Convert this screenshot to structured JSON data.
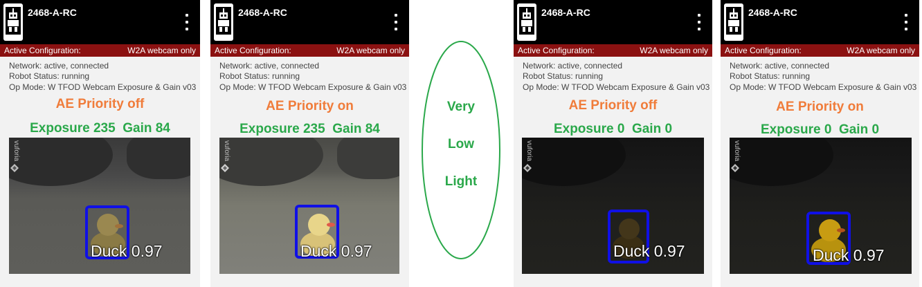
{
  "panels": [
    {
      "device": "2468-A-RC",
      "config_label": "Active Configuration:",
      "config_value": "W2A webcam only",
      "network": "Network: active, connected",
      "robot_status": "Robot Status: running",
      "op_mode": "Op Mode: W TFOD Webcam Exposure & Gain v03",
      "ae_priority": "AE Priority off",
      "exposure_gain": "Exposure 235  Gain 84",
      "vuforia": "vuforia",
      "detection": "Duck 0.97"
    },
    {
      "device": "2468-A-RC",
      "config_label": "Active Configuration:",
      "config_value": "W2A webcam only",
      "network": "Network: active, connected",
      "robot_status": "Robot Status: running",
      "op_mode": "Op Mode: W TFOD Webcam Exposure & Gain v03",
      "ae_priority": "AE Priority on",
      "exposure_gain": "Exposure 235  Gain 84",
      "vuforia": "vuforia",
      "detection": "Duck 0.97"
    },
    {
      "device": "2468-A-RC",
      "config_label": "Active Configuration:",
      "config_value": "W2A webcam only",
      "network": "Network: active, connected",
      "robot_status": "Robot Status: running",
      "op_mode": "Op Mode: W TFOD Webcam Exposure & Gain v03",
      "ae_priority": "AE Priority off",
      "exposure_gain": "Exposure 0  Gain 0",
      "vuforia": "vuforia",
      "detection": "Duck 0.97"
    },
    {
      "device": "2468-A-RC",
      "config_label": "Active Configuration:",
      "config_value": "W2A webcam only",
      "network": "Network: active, connected",
      "robot_status": "Robot Status: running",
      "op_mode": "Op Mode: W TFOD Webcam Exposure & Gain v03",
      "ae_priority": "AE Priority on",
      "exposure_gain": "Exposure 0  Gain 0",
      "vuforia": "vuforia",
      "detection": "Duck 0.97"
    }
  ],
  "ellipse_text": [
    "Very",
    "Low",
    "Light"
  ],
  "colors": {
    "appbar": "#000000",
    "config_bar": "#8b1111",
    "ae_priority": "#f07c3a",
    "exposure": "#2aa84a",
    "detection_box": "#1010e6"
  },
  "icons": [
    "robot-controller-icon",
    "overflow-menu-icon",
    "vuforia-logo-icon"
  ]
}
